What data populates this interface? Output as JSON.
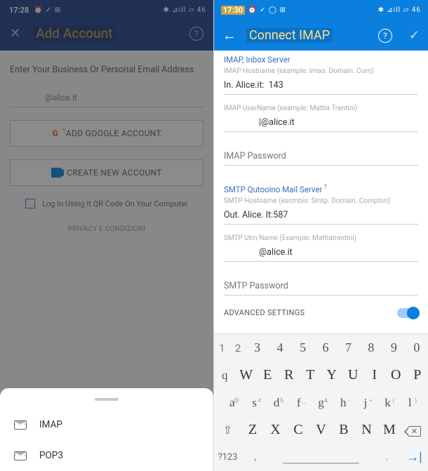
{
  "left": {
    "status": {
      "time": "17:28",
      "left_icons": "⏰ ✓ ⊞",
      "right_icons": "✱ ⊿ill ▱ 46"
    },
    "title": "Add Account",
    "prompt": "Enter Your Business Or Personal Email Address.",
    "email_placeholder": "@alice.it",
    "google_btn": "ADD GOOGLE ACCOUNT.",
    "create_btn": "CREATE NEW ACCOUNT",
    "qr_text": "Log In Using It QR Code On Your Computer",
    "footer": "PRIVACY E CONDIZIONI",
    "sheet": {
      "imap": "IMAP",
      "pop3": "POP3"
    }
  },
  "right": {
    "status": {
      "time": "17:30",
      "left_icons": "⏰ ✓ ◯ ⊞",
      "right_icons": "✱ ⊿ill ▱ 46"
    },
    "title": "Connect IMAP",
    "imap_section": "IMAP, Inbox Server",
    "imap_host_hint": "IMAP Hostname (example: Imao. Domain. Com)",
    "imap_host": "In. Alice.it:  143",
    "imap_user_hint": "IMAP UserName (example: Mattia Trentini)",
    "imap_user": "|@alice.it",
    "imap_pass": "IMAP Password",
    "smtp_section": "SMTP Qutooino Mail Server",
    "smtp_host_hint": "SMTP Hostname (escmbio: Smtp. Domain. Compton)",
    "smtp_host": "Out. Alice. It:587",
    "smtp_user_hint": "SMTP Utm Name (Example: Mattiatrentini)",
    "smtp_user": "@alice.it",
    "smtp_pass": "SMTP Password",
    "advanced": "ADVANCED SETTINGS"
  },
  "keyboard": {
    "num_small": [
      "1",
      "2"
    ],
    "num": [
      "3",
      "4",
      "5",
      "6",
      "7",
      "8",
      "9",
      "0"
    ],
    "row1": [
      "q",
      "W",
      "E",
      "R",
      "T",
      "Y",
      "U",
      "I",
      "O",
      "P"
    ],
    "row2": [
      {
        "k": "a",
        "s": "@"
      },
      {
        "k": "s",
        "s": "#"
      },
      {
        "k": "d",
        "s": "ß"
      },
      {
        "k": "f",
        "s": "_"
      },
      {
        "k": "g",
        "s": "&"
      },
      {
        "k": "h",
        "s": "-"
      },
      {
        "k": "j",
        "s": "+"
      },
      {
        "k": "k",
        "s": "("
      },
      {
        "k": "l",
        "s": ")"
      }
    ],
    "row3": [
      "Z",
      "X",
      "C",
      "V",
      "B",
      "N",
      "M"
    ],
    "sym": "?123",
    "comma": ",",
    "dot": "."
  }
}
